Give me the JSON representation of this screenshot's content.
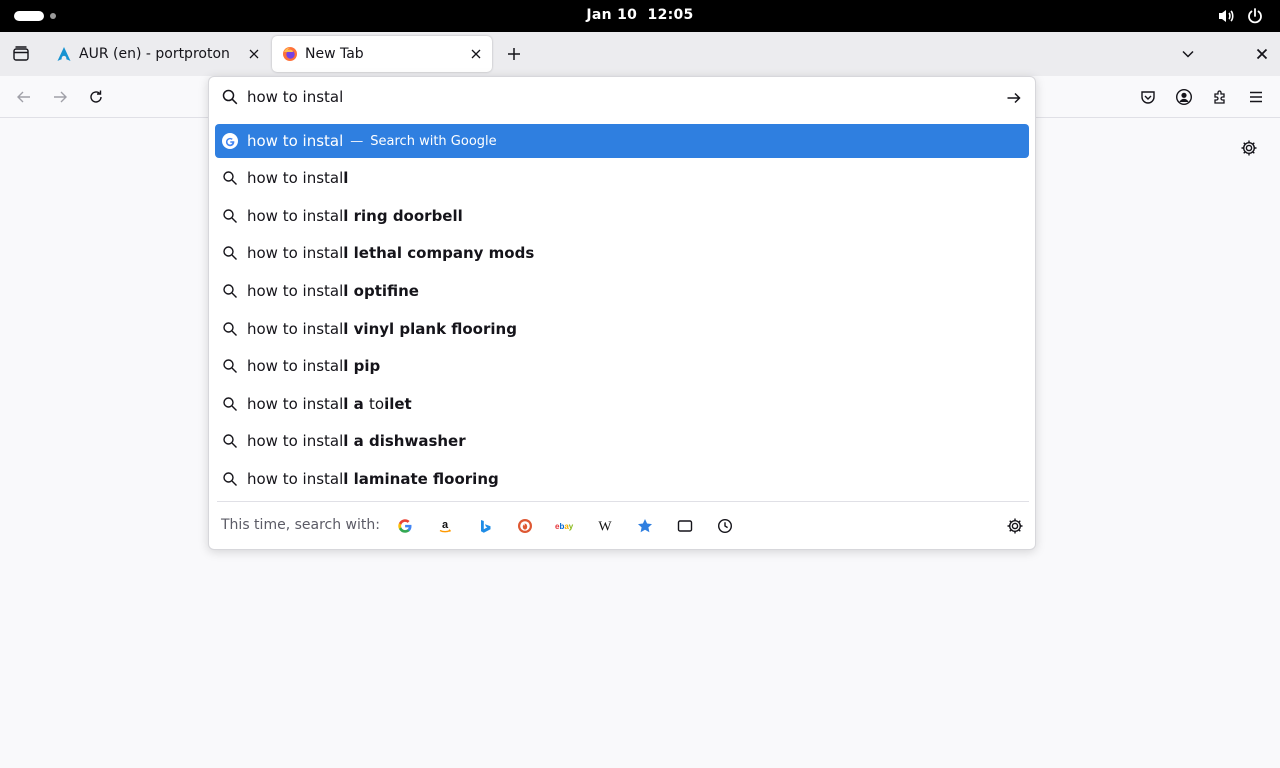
{
  "system_bar": {
    "date": "Jan 10",
    "time": "12:05",
    "icons": [
      "activities-pill",
      "volume-icon",
      "power-icon"
    ]
  },
  "tabs": [
    {
      "title": "AUR (en) - portproton",
      "favicon": "arch-linux-icon",
      "active": false
    },
    {
      "title": "New Tab",
      "favicon": "firefox-icon",
      "active": true
    }
  ],
  "toolbar_icons": [
    "back-icon",
    "forward-icon",
    "reload-icon",
    "pocket-icon",
    "account-icon",
    "extensions-icon",
    "menu-icon"
  ],
  "urlbar": {
    "value": "how to instal",
    "heuristic": {
      "text": "how to instal",
      "separator": "—",
      "action": "Search with Google"
    },
    "suggestions": [
      {
        "typed": "how to instal",
        "completion": "l"
      },
      {
        "typed": "how to instal",
        "completion": "l ring doorbell"
      },
      {
        "typed": "how to instal",
        "completion": "l lethal company mods"
      },
      {
        "typed": "how to instal",
        "completion": "l optifine"
      },
      {
        "typed": "how to instal",
        "completion": "l vinyl plank flooring"
      },
      {
        "typed": "how to instal",
        "completion": "l pip"
      },
      {
        "typed": "how to instal",
        "completion": "l a to",
        "rest_plain": "",
        "rest_bold": ""
      },
      {
        "typed": "how to instal",
        "completion": "l a dishwasher"
      },
      {
        "typed": "how to instal",
        "completion": "l laminate flooring"
      }
    ],
    "toilet_suggestion": {
      "typed": "how to instal",
      "bold1": "l a ",
      "plain": "to",
      "bold2": "ilet"
    },
    "footer_label": "This time, search with:",
    "engines": [
      "google",
      "amazon",
      "bing",
      "duckduckgo",
      "ebay",
      "wikipedia",
      "bookmarks",
      "tabs",
      "history"
    ]
  },
  "colors": {
    "selected_row": "#2f7fe0",
    "top_bar": "#000000",
    "tab_strip": "#ececef"
  }
}
